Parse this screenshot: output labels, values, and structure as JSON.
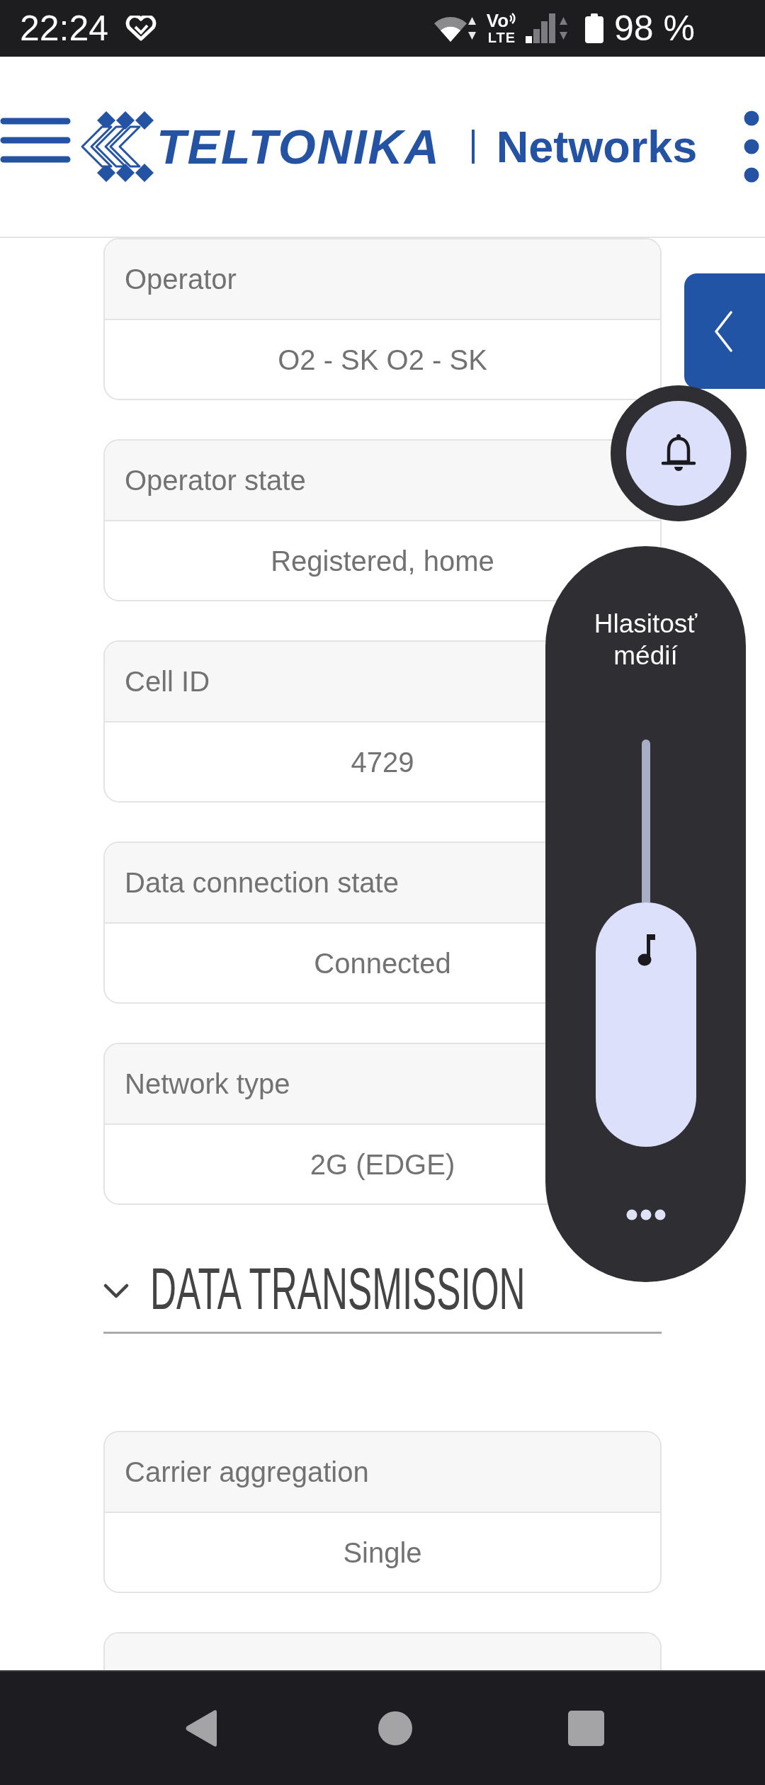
{
  "status_bar": {
    "time": "22:24",
    "volte": "Vo",
    "network": "LTE",
    "battery": "98 %"
  },
  "header": {
    "brand": "TELTONIKA",
    "product": "Networks"
  },
  "cards": [
    {
      "label": "Operator",
      "value": "O2 - SK O2 - SK"
    },
    {
      "label": "Operator state",
      "value": "Registered, home"
    },
    {
      "label": "Cell ID",
      "value": "4729"
    },
    {
      "label": "Data connection state",
      "value": "Connected"
    },
    {
      "label": "Network type",
      "value": "2G (EDGE)"
    }
  ],
  "section": {
    "title": "DATA TRANSMISSION",
    "expanded": true,
    "cards": [
      {
        "label": "Carrier aggregation",
        "value": "Single"
      }
    ]
  },
  "volume_panel": {
    "title": "Hlasitosť médií",
    "level": 0.6
  }
}
